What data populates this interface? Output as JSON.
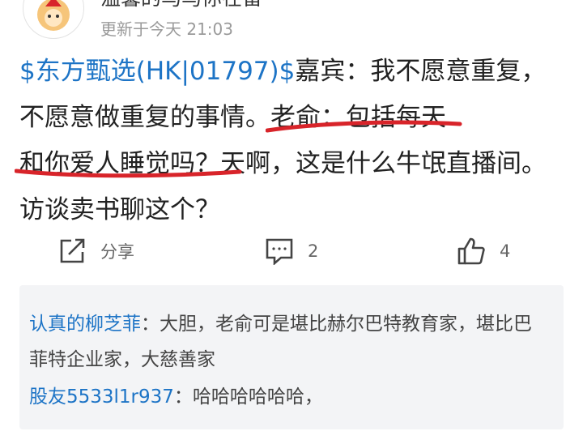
{
  "post": {
    "author": "温馨的马马你在留",
    "update_time": "更新于今天 21:03",
    "content": {
      "stock_tag": "$东方甄选(HK|01797)$",
      "part1": "嘉宾：我不愿意重复，不愿意做重复的事情。",
      "highlight1": "老俞：包括每天",
      "highlight2": "和你爱人睡觉吗？",
      "part2": "天啊，这是什么牛氓直播间。访谈卖书聊这个？"
    },
    "actions": {
      "share_label": "分享",
      "comment_count": "2",
      "like_count": "4"
    }
  },
  "comments": [
    {
      "user": "认真的柳芝菲",
      "text": "：大胆，老俞可是堪比赫尔巴特教育家，堪比巴菲特企业家，大慈善家"
    },
    {
      "user": "股友5533l1r937",
      "text": "：哈哈哈哈哈哈，"
    }
  ],
  "colors": {
    "link": "#1d74c6",
    "annotation": "#d8242a",
    "muted": "#9a9a9a",
    "comment_bg": "#f3f4f6"
  },
  "icons": [
    "avatar-icon",
    "share-icon",
    "comment-icon",
    "like-icon"
  ]
}
